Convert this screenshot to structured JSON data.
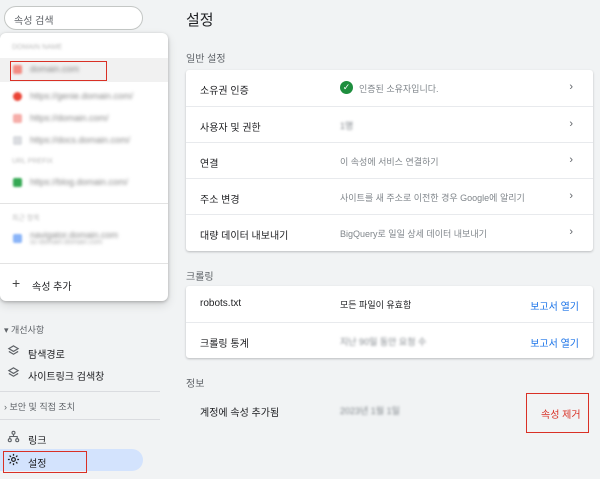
{
  "sidebar": {
    "search_placeholder": "속성 검색",
    "dropdown": {
      "group1_label": "DOMAIN NAME",
      "items1": [
        {
          "label": "domain.com",
          "sub": "",
          "color": "#f28b82"
        },
        {
          "label": "https://genie.domain.com/",
          "sub": "",
          "color": "#ea4335"
        },
        {
          "label": "https://domain.com/",
          "sub": "",
          "color": "#f6aea9"
        },
        {
          "label": "https://docs.domain.com/",
          "sub": "",
          "color": "#dadce0"
        }
      ],
      "group2_label": "URL PREFIX",
      "items2": [
        {
          "label": "https://blog.domain.com/",
          "sub": "",
          "color": "#34a853"
        }
      ],
      "group3_label": "최근 항목",
      "items3": [
        {
          "label": "navigator.domain.com",
          "sub": "sc-domain:domain.com",
          "color": "#8ab4f8"
        }
      ],
      "add_property": "속성 추가"
    },
    "section_improve": "개선사항",
    "nav_breadcrumbs": "탐색경로",
    "nav_sitelinks": "사이트링크 검색창",
    "section_security": "보안 및 직접 조치",
    "nav_links": "링크",
    "nav_settings": "설정"
  },
  "main": {
    "title": "설정",
    "general_title": "일반 설정",
    "general_rows": [
      {
        "key": "소유권 인증",
        "value": "인증된 소유자입니다.",
        "check": true
      },
      {
        "key": "사용자 및 권한",
        "value": "1명",
        "blur": true
      },
      {
        "key": "연결",
        "value": "이 속성에 서비스 연결하기"
      },
      {
        "key": "주소 변경",
        "value": "사이트를 새 주소로 이전한 경우 Google에 알리기"
      },
      {
        "key": "대량 데이터 내보내기",
        "value": "BigQuery로 일일 상세 데이터 내보내기"
      }
    ],
    "crawl_title": "크롤링",
    "crawl_rows": [
      {
        "key": "robots.txt",
        "value": "모든 파일이 유효함",
        "link": "보고서 열기"
      },
      {
        "key": "크롤링 통계",
        "value": "지난 90일 동안 요청 수",
        "link": "보고서 열기",
        "blur": true
      }
    ],
    "about_title": "정보",
    "about_key": "계정에 속성 추가됨",
    "about_value": "2023년 1월 1일",
    "remove_label": "속성 제거"
  }
}
